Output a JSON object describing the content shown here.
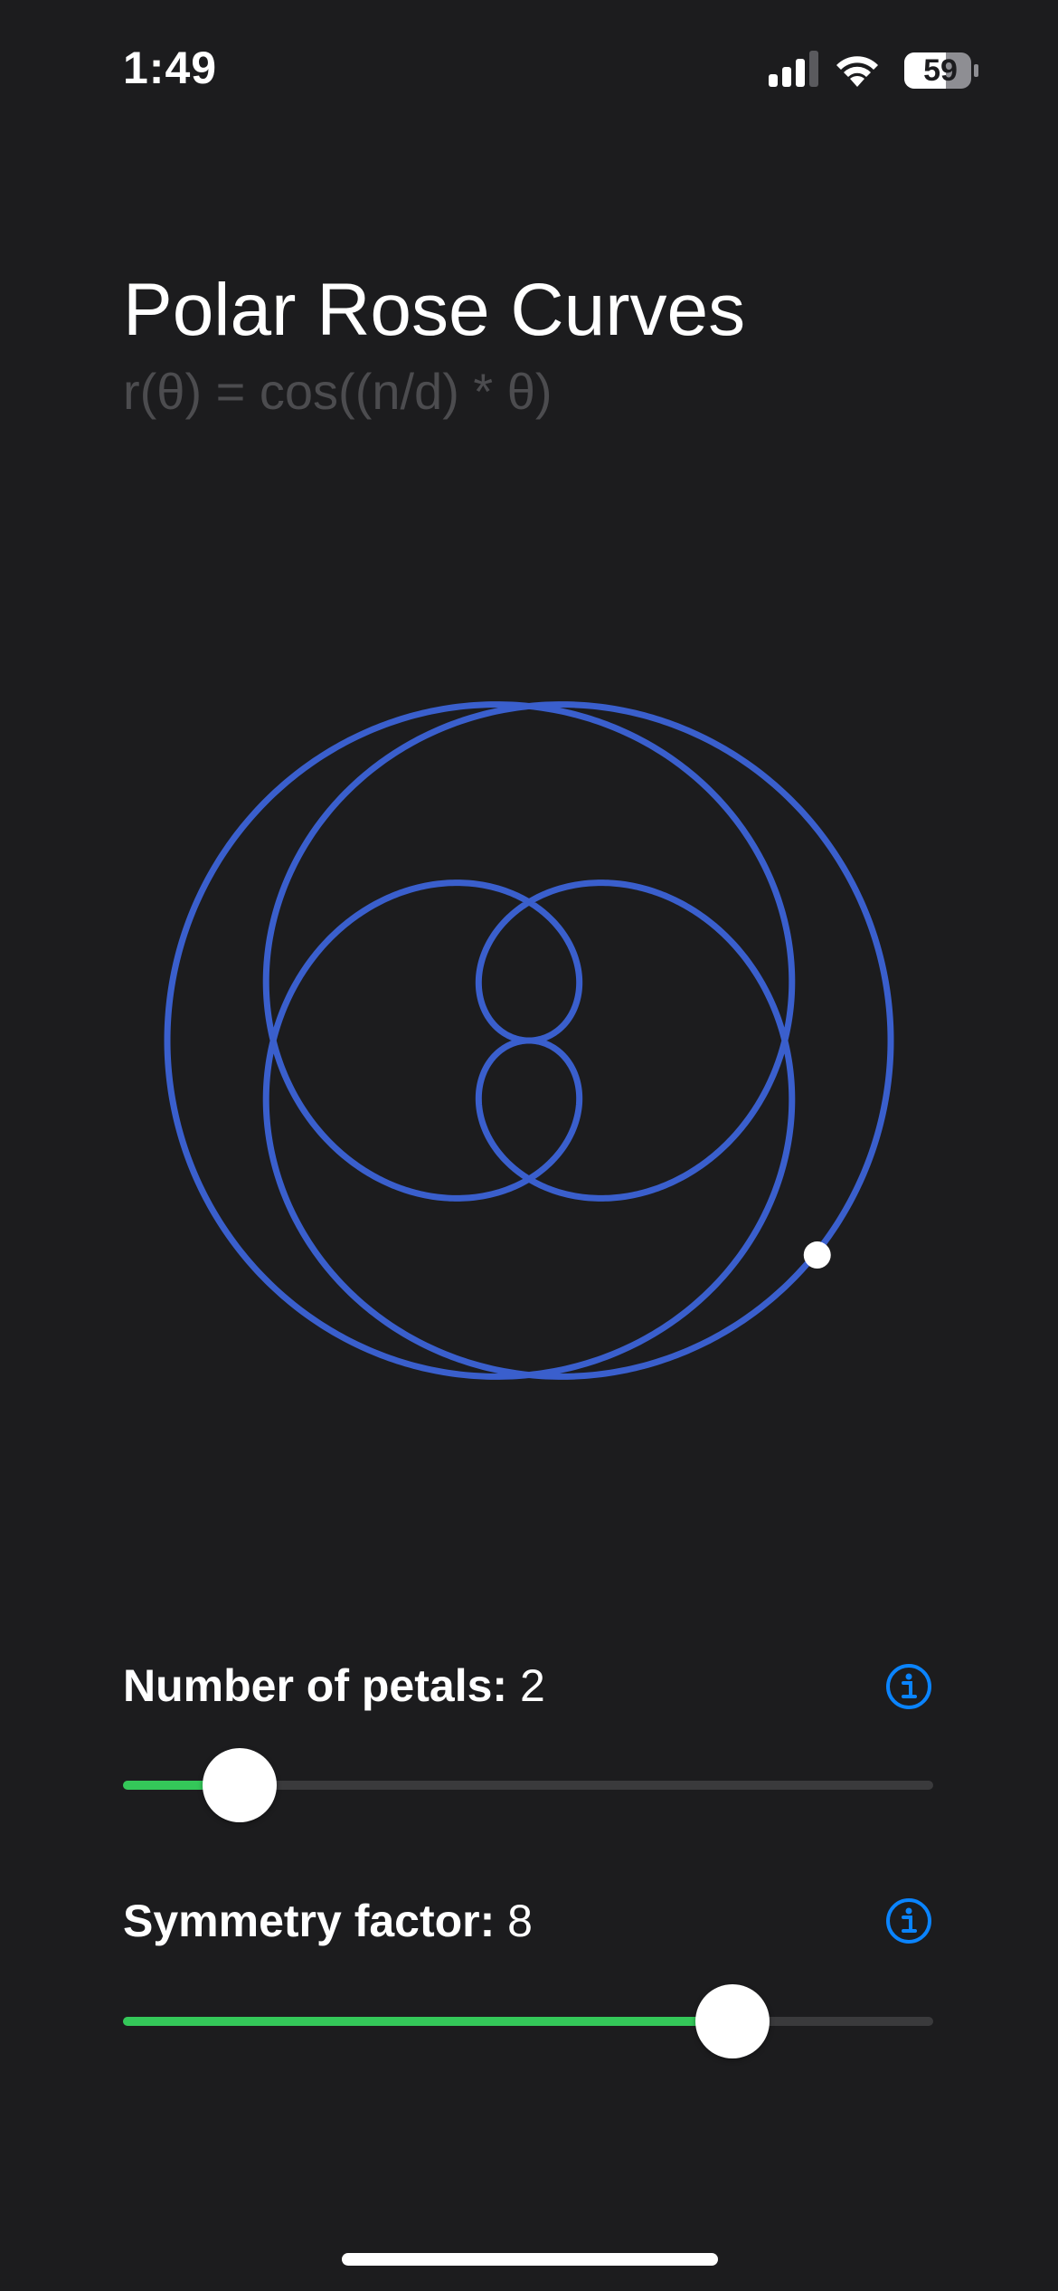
{
  "status_bar": {
    "time": "1:49",
    "battery": "59",
    "icons": [
      "signal-icon",
      "wifi-icon",
      "battery-icon"
    ]
  },
  "header": {
    "title": "Polar Rose Curves",
    "formula": "r(θ) = cos((n/d) * θ)"
  },
  "graph": {
    "n": 2,
    "d": 8,
    "curve_color": "#3a5fcd",
    "marker_color": "#ffffff"
  },
  "controls": {
    "petals": {
      "label": "Number of petals:",
      "value": "2",
      "slider_fraction": 0.144,
      "info_icon": "info-icon"
    },
    "symmetry": {
      "label": "Symmetry factor:",
      "value": "8",
      "slider_fraction": 0.752,
      "info_icon": "info-icon"
    }
  },
  "colors": {
    "background": "#1c1c1e",
    "accent": "#34c759",
    "info": "#0a84ff",
    "track": "#3a3a3c",
    "formula_text": "#4c4c4f"
  }
}
